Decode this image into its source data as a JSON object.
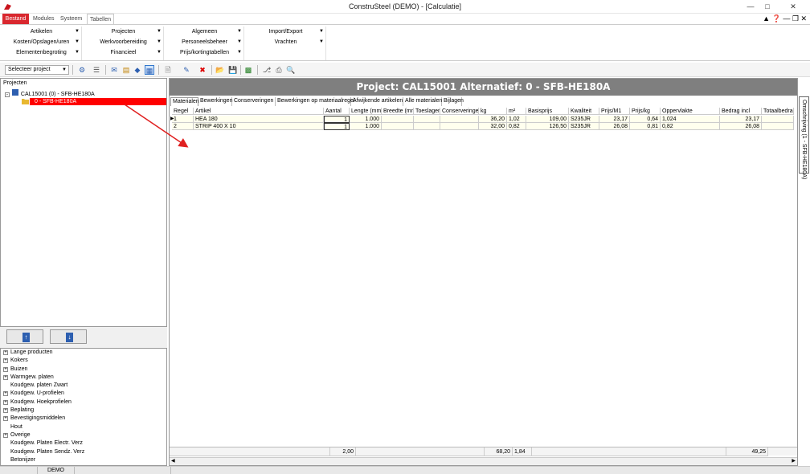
{
  "window": {
    "title": "ConstruSteel (DEMO) - [Calculatie]"
  },
  "ribbon_tabs": [
    "Bestand",
    "Modules",
    "Systeem",
    "Tabellen"
  ],
  "ribbon": {
    "col1": [
      "Artikelen",
      "Kosten/Opslagen/uren",
      "Elementenbegroting"
    ],
    "col2": [
      "Projecten",
      "Werkvoorbereiding",
      "Financieel"
    ],
    "col3": [
      "Algemeen",
      "Personeelsbeheer",
      "Prijs/kortingtabellen"
    ],
    "col4": [
      "Import/Export",
      "Vrachten"
    ]
  },
  "toolbar": {
    "project_select": "Selecteer project"
  },
  "left_panel": {
    "label": "Projecten",
    "root": "CAL15001 (0) - SFB-HE180A",
    "child": "0 - SFB-HE180A"
  },
  "categories": [
    {
      "label": "Lange producten",
      "expandable": true
    },
    {
      "label": "Kokers",
      "expandable": true
    },
    {
      "label": "Buizen",
      "expandable": true
    },
    {
      "label": "Warmgew. platen",
      "expandable": true
    },
    {
      "label": "Koudgew. platen Zwart",
      "expandable": false
    },
    {
      "label": "Koudgew. U-profielen",
      "expandable": true
    },
    {
      "label": "Koudgew. Hoekprofielen",
      "expandable": true
    },
    {
      "label": "Beplating",
      "expandable": true
    },
    {
      "label": "Bevestigingsmiddelen",
      "expandable": true
    },
    {
      "label": "Hout",
      "expandable": false
    },
    {
      "label": "Overige",
      "expandable": true
    },
    {
      "label": "Koudgew. Platen Electr. Verz",
      "expandable": false
    },
    {
      "label": "Koudgew. Platen Sendz. Verz",
      "expandable": false
    },
    {
      "label": "Betonijzer",
      "expandable": false
    }
  ],
  "status": {
    "mode": "DEMO"
  },
  "main": {
    "header": "Project: CAL15001 Alternatief: 0 - SFB-HE180A",
    "tabs": [
      "Materialen",
      "Bewerkingen",
      "Conserveringen",
      "Bewerkingen op materiaalregel",
      "Afwijkende artikelen",
      "Alle materialen",
      "Bijlagen"
    ],
    "columns": [
      "Regel",
      "Artikel",
      "Aantal",
      "Lengte (mm)",
      "Breedte (mm)",
      "Toeslagen",
      "Conserveringen",
      "kg",
      "m²",
      "Basisprijs",
      "Kwaliteit",
      "Prijs/M1",
      "Prijs/kg",
      "Oppervlakte",
      "Bedrag incl",
      "Totaalbedrag"
    ],
    "rows": [
      [
        "1",
        "HEA  180",
        "1",
        "1.000",
        "",
        "",
        "",
        "36,20",
        "1,02",
        "109,00",
        "S235JR",
        "23,17",
        "0,64",
        "1,024",
        "23,17",
        ""
      ],
      [
        "2",
        "STRIP 400 X 10",
        "1",
        "1.000",
        "",
        "",
        "",
        "32,00",
        "0,82",
        "126,50",
        "S235JR",
        "26,08",
        "0,81",
        "0,82",
        "26,08",
        ""
      ]
    ],
    "totals": {
      "aantal": "2,00",
      "kg": "68,20",
      "m2": "1,84",
      "bedrag": "49,25"
    },
    "side_tab": "Omschrijving (1 - SFB-HE180A)"
  },
  "colors": {
    "bestand_red": "#d9282f",
    "selection_red": "#ff0000",
    "header_grey": "#7f7f7f",
    "row_yellow": "#ffffee",
    "arrow_red": "#e02020"
  }
}
